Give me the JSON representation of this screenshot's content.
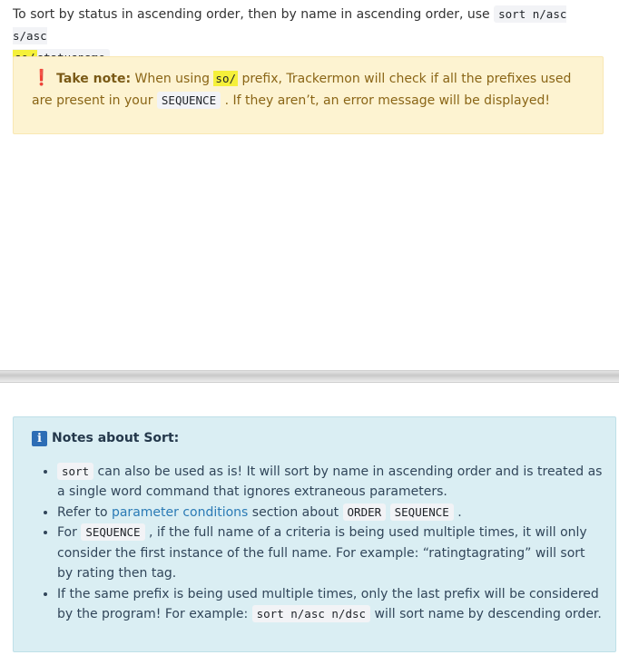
{
  "intro": {
    "text_before": "To sort by status in ascending order, then by name in ascending order, use ",
    "code_part1": "sort n/asc s/asc",
    "code_so": "so/",
    "code_part2": "statusname",
    "text_after": " ."
  },
  "note": {
    "label": "Take note:",
    "text1": " When using ",
    "code_so": "so/",
    "text2": " prefix, Trackermon will check if all the prefixes used are present in your ",
    "code_sequence": "SEQUENCE",
    "text3": " . If they aren’t, an error message will be displayed!"
  },
  "info": {
    "title": "Notes about Sort:",
    "items": [
      {
        "code": "sort",
        "text": " can also be used as is! It will sort by name in ascending order and is treated as a single word command that ignores extraneous parameters."
      },
      {
        "text1": "Refer to ",
        "link": "parameter conditions",
        "text2": " section about ",
        "code1": "ORDER",
        "code2": "SEQUENCE",
        "text3": " ."
      },
      {
        "text1": "For ",
        "code": "SEQUENCE",
        "text2": " , if the full name of a criteria is being used multiple times, it will only consider the first instance of the full name. For example: “ratingtagrating” will sort by rating then tag."
      },
      {
        "text1": "If the same prefix is being used multiple times, only the last prefix will be considered by the program! For example: ",
        "code": "sort n/asc n/dsc",
        "text2": " will sort name by descending order."
      }
    ]
  }
}
